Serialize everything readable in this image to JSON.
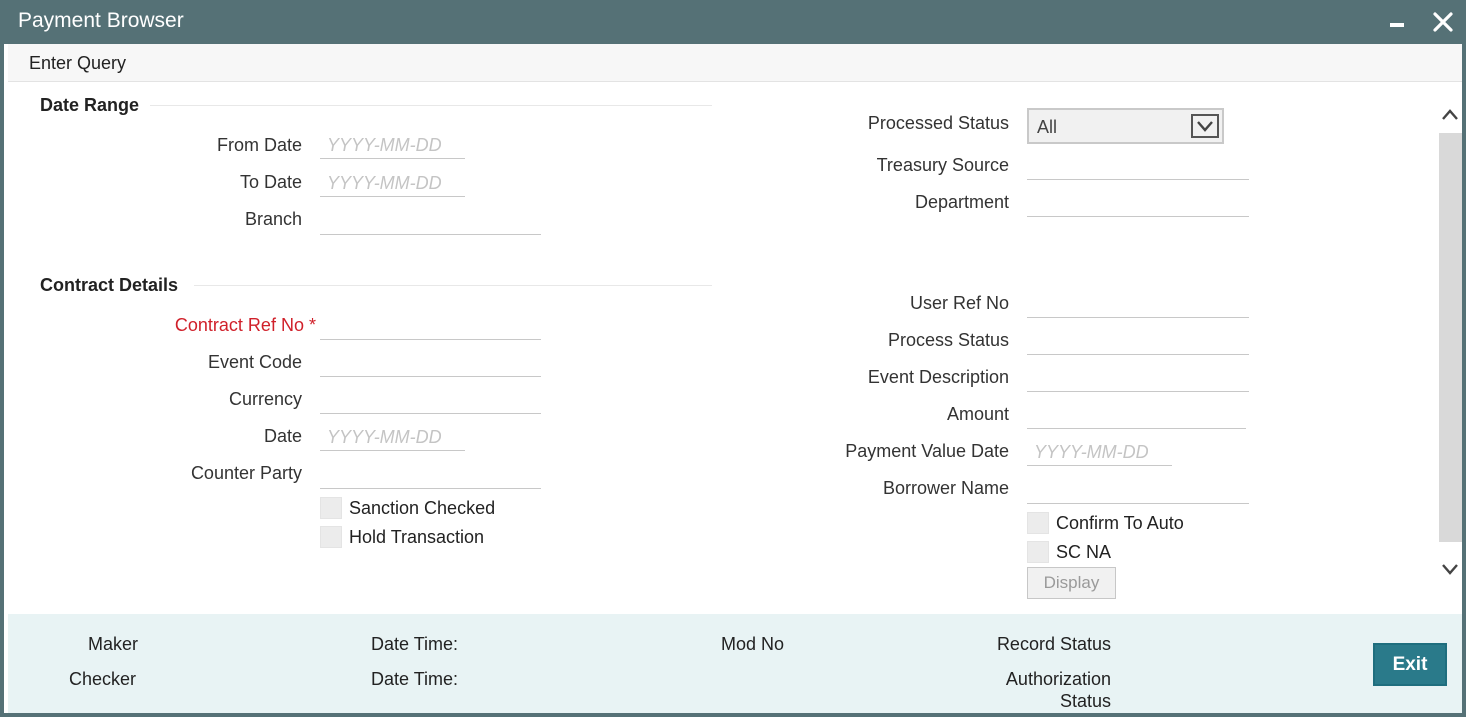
{
  "window": {
    "title": "Payment Browser"
  },
  "menu": {
    "enter_query": "Enter Query"
  },
  "date_range": {
    "title": "Date Range",
    "from_date_label": "From Date",
    "to_date_label": "To Date",
    "branch_label": "Branch",
    "date_placeholder": "YYYY-MM-DD"
  },
  "right_top": {
    "processed_status_label": "Processed Status",
    "processed_status_value": "All",
    "treasury_source_label": "Treasury Source",
    "department_label": "Department"
  },
  "contract_details": {
    "title": "Contract Details",
    "contract_ref_label": "Contract Ref No",
    "required_mark": "*",
    "event_code_label": "Event Code",
    "currency_label": "Currency",
    "date_label": "Date",
    "counter_party_label": "Counter Party",
    "sanction_checked_label": "Sanction Checked",
    "hold_transaction_label": "Hold Transaction"
  },
  "right_bottom": {
    "user_ref_label": "User Ref No",
    "process_status_label": "Process Status",
    "event_description_label": "Event Description",
    "amount_label": "Amount",
    "payment_value_date_label": "Payment Value Date",
    "borrower_name_label": "Borrower Name",
    "confirm_to_auto_label": "Confirm To Auto",
    "sc_na_label": "SC NA",
    "display_button": "Display"
  },
  "footer": {
    "maker": "Maker",
    "checker": "Checker",
    "date_time_1": "Date Time:",
    "date_time_2": "Date Time:",
    "mod_no": "Mod No",
    "record_status": "Record Status",
    "authorization": "Authorization",
    "status": "Status",
    "exit_button": "Exit"
  },
  "colors": {
    "titlebar": "#557176",
    "footer_bg": "#e8f3f4",
    "exit_button": "#2a7a8a",
    "required": "#d0202a"
  },
  "icons": {
    "minimize": "minimize-icon",
    "close": "close-icon",
    "dropdown": "chevron-down-icon",
    "scroll_up": "chevron-up-icon",
    "scroll_down": "chevron-down-icon"
  }
}
